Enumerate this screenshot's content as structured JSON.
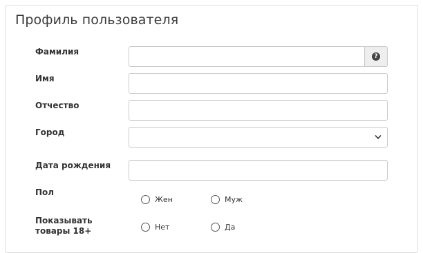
{
  "panel": {
    "title": "Профиль пользователя"
  },
  "fields": {
    "last_name": {
      "label": "Фамилия",
      "value": ""
    },
    "first_name": {
      "label": "Имя",
      "value": ""
    },
    "patronymic": {
      "label": "Отчество",
      "value": ""
    },
    "city": {
      "label": "Город",
      "value": ""
    },
    "birth_date": {
      "label": "Дата рождения",
      "value": ""
    },
    "gender": {
      "label": "Пол",
      "options": [
        "Жен",
        "Муж"
      ]
    },
    "adult_goods": {
      "label_line1": "Показывать",
      "label_line2": "товары 18+",
      "options": [
        "Нет",
        "Да"
      ]
    }
  },
  "icons": {
    "help": "question-circle-icon",
    "dropdown": "chevron-down-icon"
  },
  "colors": {
    "border": "#c9c9c9",
    "addon_bg": "#eeeeee",
    "text": "#333333"
  }
}
